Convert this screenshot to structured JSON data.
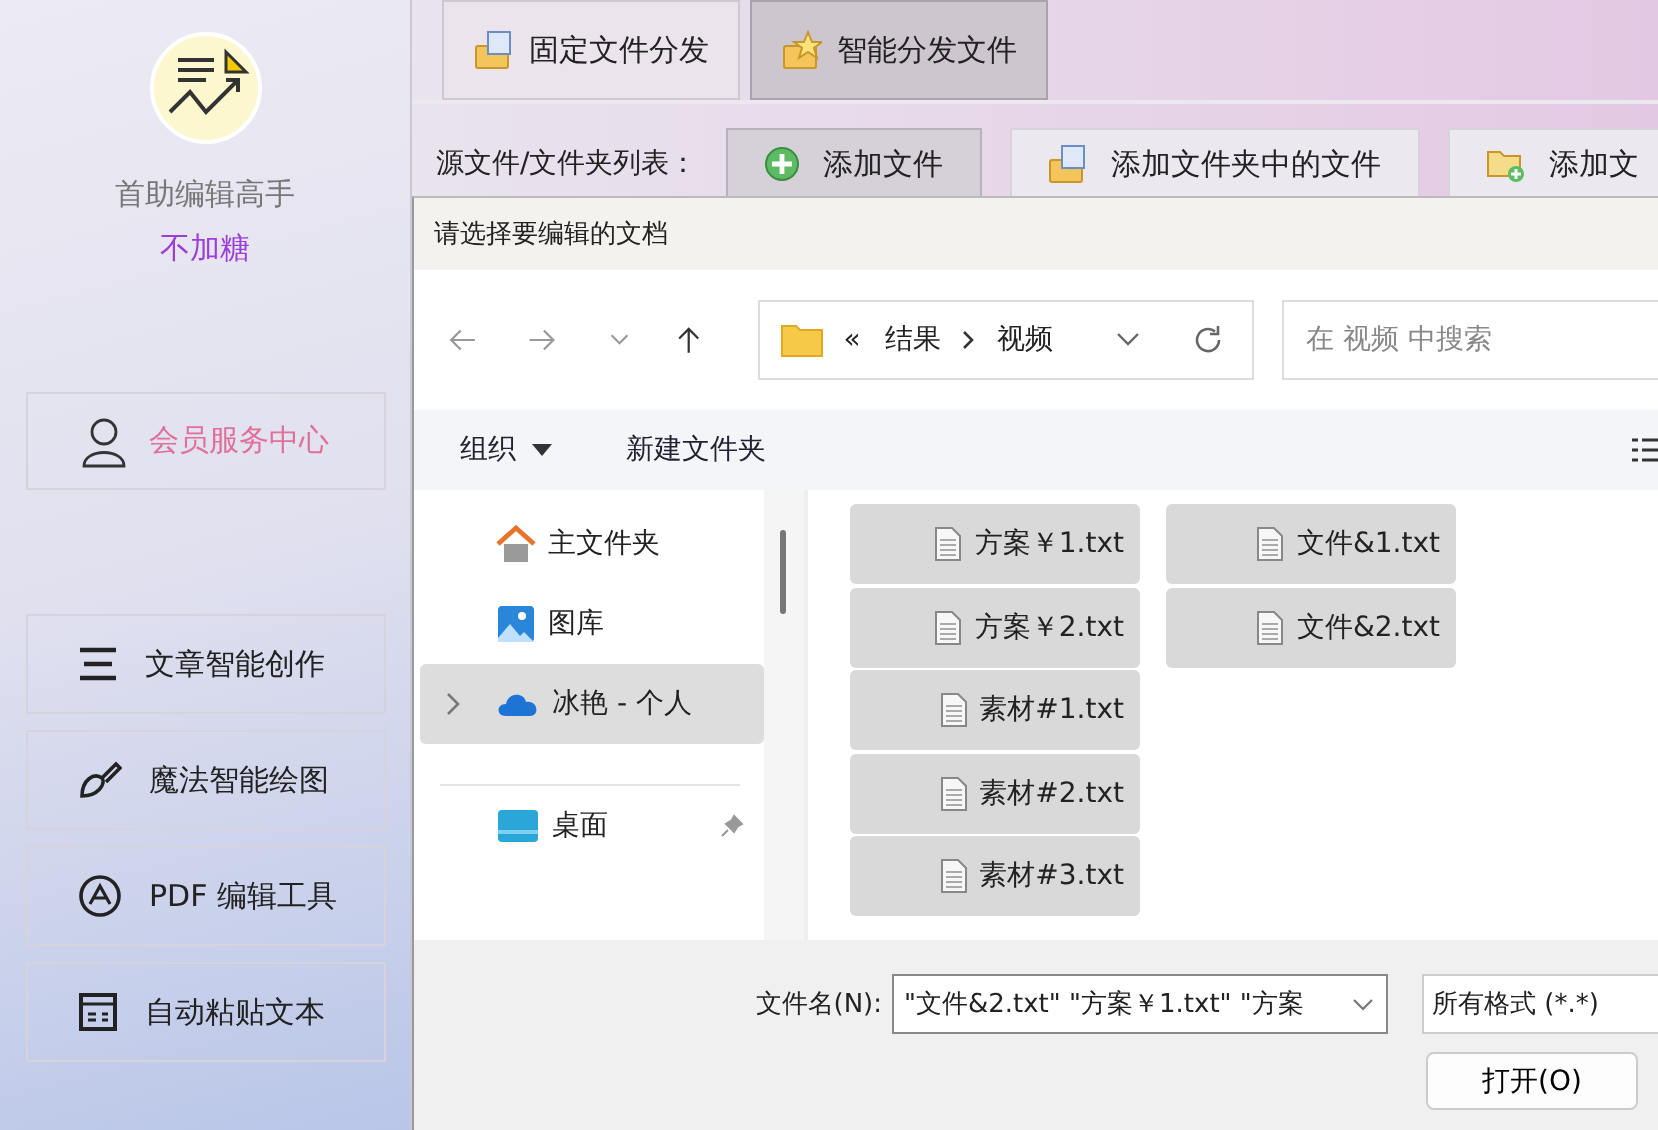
{
  "app": {
    "title": "首助编辑高手",
    "user_name": "不加糖",
    "member_button": "会员服务中心",
    "menu": [
      {
        "label": "文章智能创作",
        "kind": "lines"
      },
      {
        "label": "魔法智能绘图",
        "kind": "brush"
      },
      {
        "label": "PDF 编辑工具",
        "kind": "pdf"
      },
      {
        "label": "自动粘贴文本",
        "kind": "paste"
      }
    ]
  },
  "mode_tabs": [
    {
      "label": "固定文件分发",
      "selected": false
    },
    {
      "label": "智能分发文件",
      "selected": true
    }
  ],
  "source_label": "源文件/文件夹列表：",
  "source_buttons": [
    {
      "label": "添加文件",
      "kind": "add",
      "selected": true
    },
    {
      "label": "添加文件夹中的文件",
      "kind": "folder-files",
      "selected": false
    },
    {
      "label": "添加文",
      "kind": "add-folder",
      "selected": false
    }
  ],
  "dialog": {
    "title": "请选择要编辑的文档",
    "breadcrumb": {
      "overflow": "«",
      "items": [
        "结果",
        "视频"
      ]
    },
    "search": {
      "placeholder": "在 视频 中搜索"
    },
    "commands": [
      {
        "label": "组织",
        "dropdown": true
      },
      {
        "label": "新建文件夹",
        "dropdown": false
      }
    ],
    "nav": [
      {
        "label": "主文件夹",
        "kind": "home",
        "selected": false,
        "expandable": false,
        "pinned": false
      },
      {
        "label": "图库",
        "kind": "gallery",
        "selected": false,
        "expandable": false,
        "pinned": false
      },
      {
        "label": "冰艳 - 个人",
        "kind": "cloud",
        "selected": true,
        "expandable": true,
        "pinned": false
      },
      {
        "label": "桌面",
        "kind": "desktop",
        "selected": false,
        "expandable": false,
        "pinned": true
      }
    ],
    "files": [
      {
        "name": "方案￥1.txt",
        "selected": true
      },
      {
        "name": "方案￥2.txt",
        "selected": true
      },
      {
        "name": "素材#1.txt",
        "selected": true
      },
      {
        "name": "素材#2.txt",
        "selected": true
      },
      {
        "name": "素材#3.txt",
        "selected": true
      },
      {
        "name": "文件&1.txt",
        "selected": true
      },
      {
        "name": "文件&2.txt",
        "selected": true
      }
    ],
    "filename_label": "文件名(N):",
    "filename_value": "\"文件&2.txt\" \"方案￥1.txt\" \"方案",
    "filetype": "所有格式 (*.*)",
    "open_button": "打开(O)"
  }
}
